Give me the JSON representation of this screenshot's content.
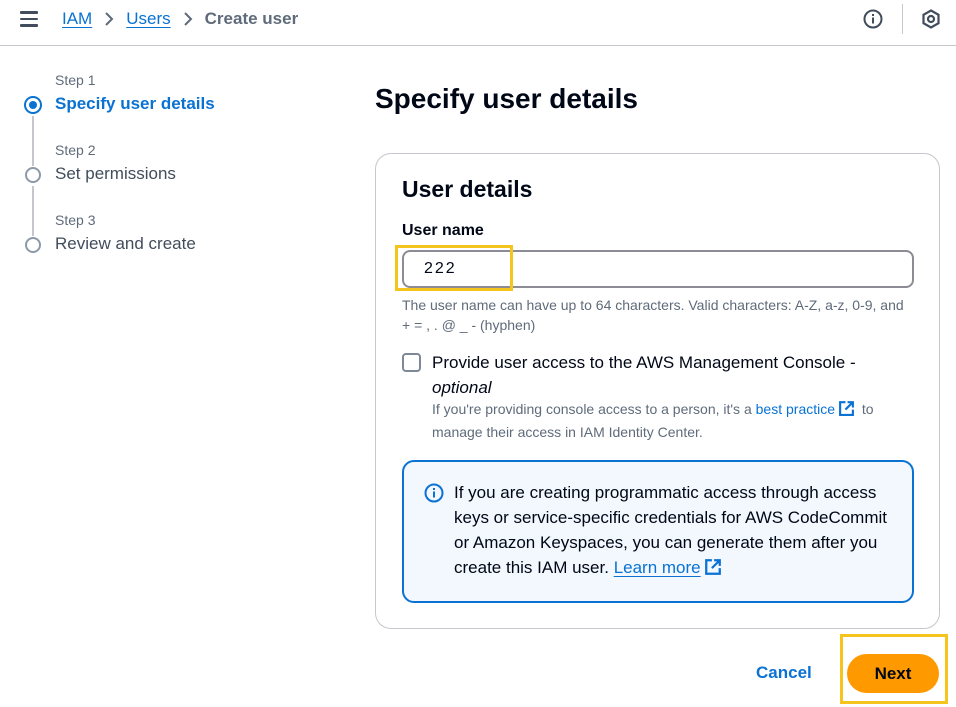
{
  "topbar": {
    "menu_icon": "hamburger-icon",
    "breadcrumbs": [
      {
        "label": "IAM",
        "link": true
      },
      {
        "label": "Users",
        "link": true
      },
      {
        "label": "Create user",
        "link": false
      }
    ],
    "icons": [
      "info-icon",
      "settings-hexagon-icon"
    ]
  },
  "steps": [
    {
      "number": "Step 1",
      "title": "Specify user details",
      "active": true
    },
    {
      "number": "Step 2",
      "title": "Set permissions",
      "active": false
    },
    {
      "number": "Step 3",
      "title": "Review and create",
      "active": false
    }
  ],
  "main": {
    "title": "Specify user details",
    "container": {
      "title": "User details",
      "username_label": "User name",
      "username_value": "222",
      "username_hint": "The user name can have up to 64 characters. Valid characters: A-Z, a-z, 0-9, and + = , . @ _ - (hyphen)",
      "console_access": {
        "checked": false,
        "label": "Provide user access to the AWS Management Console -",
        "label_optional": "optional",
        "desc_before": "If you're providing console access to a person, it's a",
        "desc_link": "best practice",
        "desc_after": "to manage their access in IAM Identity Center."
      },
      "info": {
        "text": "If you are creating programmatic access through access keys or service-specific credentials for AWS CodeCommit or Amazon Keyspaces, you can generate them after you create this IAM user.",
        "link": "Learn more"
      }
    }
  },
  "footer": {
    "cancel_label": "Cancel",
    "next_label": "Next"
  },
  "colors": {
    "accent": "#0972d3",
    "primary_button": "#ff9900",
    "highlight": "#f5c51d"
  }
}
